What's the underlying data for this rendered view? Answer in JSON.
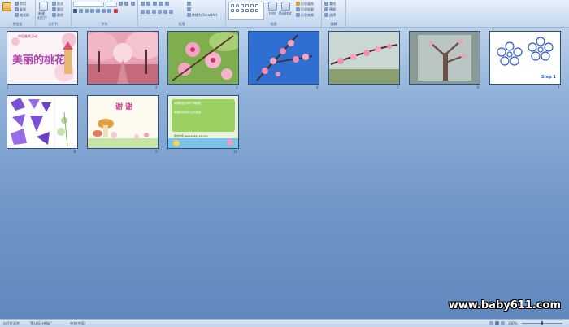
{
  "ribbon": {
    "groups": [
      {
        "label": "剪贴板",
        "items": [
          "剪切",
          "复制",
          "格式刷"
        ]
      },
      {
        "label": "幻灯片",
        "items": [
          "新建",
          "幻灯片",
          "版式",
          "重设",
          "删除"
        ]
      },
      {
        "label": "字体",
        "items": []
      },
      {
        "label": "段落",
        "items": [
          "转换为 SmartArt"
        ]
      },
      {
        "label": "绘图",
        "items": [
          "排列",
          "快速样式",
          "形状填充",
          "形状轮廓",
          "形状效果"
        ]
      },
      {
        "label": "编辑",
        "items": [
          "查找",
          "替换",
          "选择"
        ]
      }
    ]
  },
  "slides": [
    {
      "number": "1",
      "title": "美丽的桃花",
      "subtitle": "中班美术活动"
    },
    {
      "number": "2"
    },
    {
      "number": "3"
    },
    {
      "number": "4"
    },
    {
      "number": "5"
    },
    {
      "number": "6"
    },
    {
      "number": "7",
      "label": "Step 1"
    },
    {
      "number": "8"
    },
    {
      "number": "9",
      "title": "谢 谢"
    },
    {
      "number": "10",
      "heading": "本课件由小学学习网提供",
      "body": "本课件仅供学习交流使用",
      "footer": "欢迎访问 www.baby611.com"
    }
  ],
  "watermark": "www.baby611.com",
  "statusbar": {
    "slide_info": "幻灯片浏览",
    "theme": "\"默认设计模板\"",
    "language": "中文(中国)",
    "zoom": "100%"
  },
  "colors": {
    "accent": "#5f87bd",
    "ribbon": "#d2e0f2"
  }
}
